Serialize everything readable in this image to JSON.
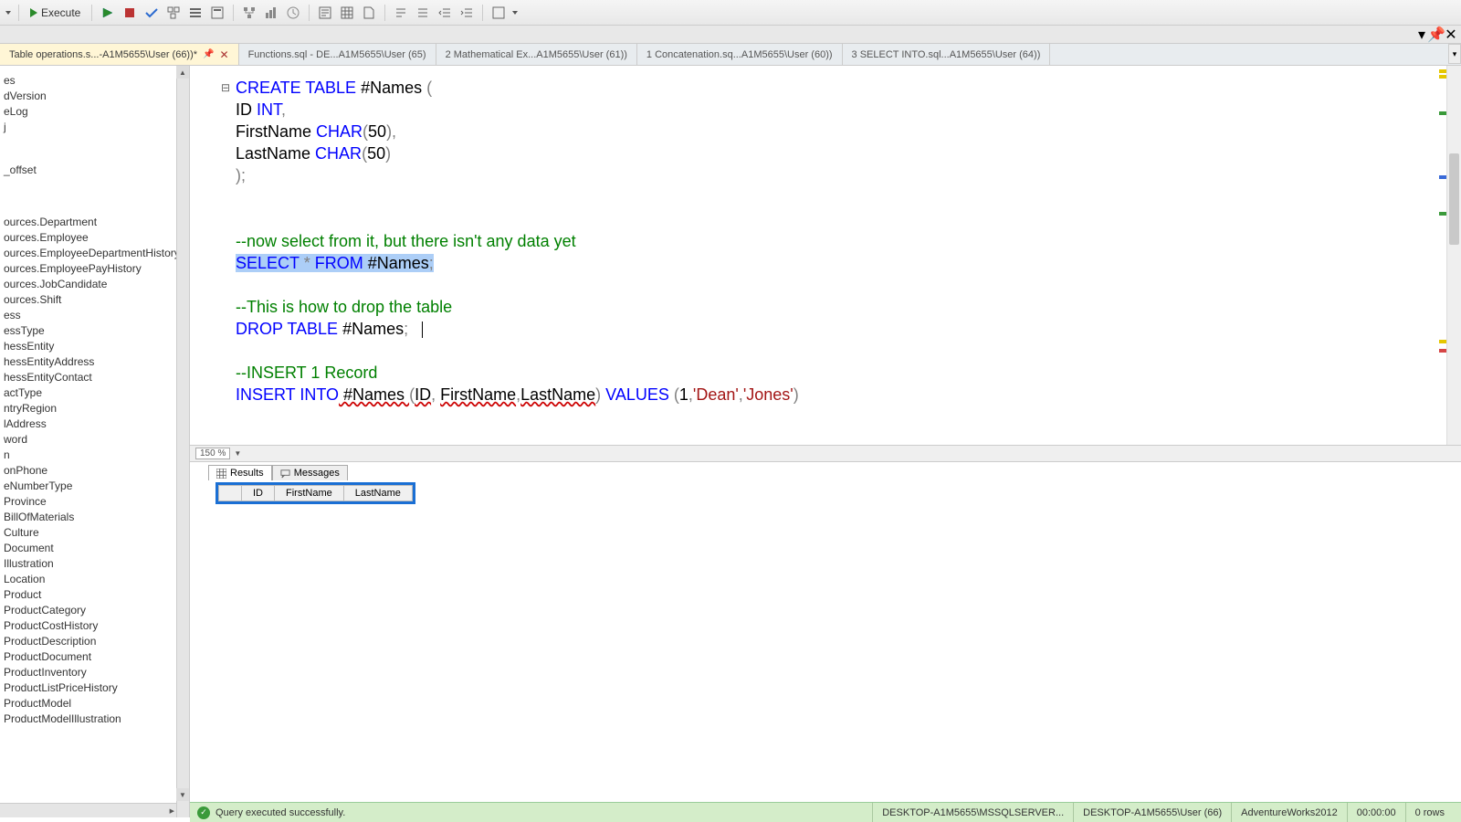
{
  "toolbar": {
    "execute_label": "Execute"
  },
  "tabs": [
    {
      "label": "Table operations.s...-A1M5655\\User (66))*",
      "active": true,
      "closeable": true
    },
    {
      "label": "Functions.sql - DE...A1M5655\\User (65)",
      "active": false
    },
    {
      "label": "2 Mathematical Ex...A1M5655\\User (61))",
      "active": false
    },
    {
      "label": "1 Concatenation.sq...A1M5655\\User (60))",
      "active": false
    },
    {
      "label": "3 SELECT INTO.sql...A1M5655\\User (64))",
      "active": false
    }
  ],
  "tree_top": [
    "es",
    "dVersion",
    "eLog",
    "j"
  ],
  "tree_mid": [
    "_offset"
  ],
  "tree_bot": [
    "ources.Department",
    "ources.Employee",
    "ources.EmployeeDepartmentHistory",
    "ources.EmployeePayHistory",
    "ources.JobCandidate",
    "ources.Shift",
    "ess",
    "essType",
    "hessEntity",
    "hessEntityAddress",
    "hessEntityContact",
    "actType",
    "ntryRegion",
    "lAddress",
    "word",
    "n",
    "onPhone",
    "eNumberType",
    "Province",
    "BillOfMaterials",
    "Culture",
    "Document",
    "Illustration",
    "Location",
    "Product",
    "ProductCategory",
    "ProductCostHistory",
    "ProductDescription",
    "ProductDocument",
    "ProductInventory",
    "ProductListPriceHistory",
    "ProductModel",
    "ProductModelIllustration"
  ],
  "code": {
    "l1": {
      "a": "CREATE",
      "b": " TABLE",
      "c": " #Names ",
      "d": "("
    },
    "l2": {
      "a": "ID ",
      "b": "INT",
      "c": ","
    },
    "l3": {
      "a": "FirstName ",
      "b": "CHAR",
      "c": "(",
      "d": "50",
      "e": "),"
    },
    "l4": {
      "a": "LastName ",
      "b": "CHAR",
      "c": "(",
      "d": "50",
      "e": ")"
    },
    "l5": ");",
    "l6": "--now select from it, but there isn't any data yet",
    "l7": {
      "a": "SELECT",
      "b": " *",
      "c": " FROM",
      "d": " #Names",
      "e": ";"
    },
    "l8": "--This is how to drop the table",
    "l9": {
      "a": "DROP",
      "b": " TABLE",
      "c": " #Names",
      "d": ";"
    },
    "l10": "--INSERT 1 Record",
    "l11": {
      "a": "INSERT",
      "b": " INTO",
      "c": " #Names ",
      "d": "(",
      "e": "ID",
      "f": ", ",
      "g": "FirstName",
      "h": ",",
      "i": "LastName",
      "j": ")",
      "k": " VALUES ",
      "l": "(",
      "m": "1",
      "n": ",",
      "o": "'Dean'",
      "p": ",",
      "q": "'Jones'",
      "r": ")"
    }
  },
  "zoom": "150 %",
  "results_tabs": {
    "results": "Results",
    "messages": "Messages"
  },
  "grid_headers": [
    "ID",
    "FirstName",
    "LastName"
  ],
  "status": {
    "msg": "Query executed successfully.",
    "server": "DESKTOP-A1M5655\\MSSQLSERVER...",
    "user": "DESKTOP-A1M5655\\User (66)",
    "db": "AdventureWorks2012",
    "time": "00:00:00",
    "rows": "0 rows"
  }
}
